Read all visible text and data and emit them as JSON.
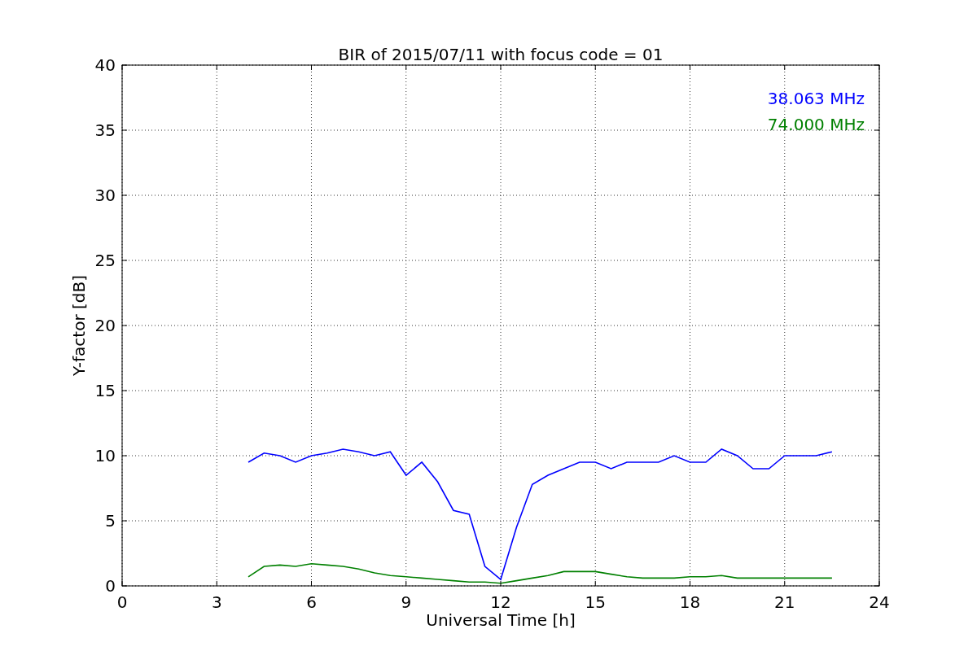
{
  "figure": {
    "chart_data": {
      "type": "line",
      "title": "BIR of 2015/07/11 with focus code = 01",
      "xlabel": "Universal Time [h]",
      "ylabel": "Y-factor [dB]",
      "x": [
        4.0,
        4.5,
        5.0,
        5.5,
        6.0,
        6.5,
        7.0,
        7.5,
        8.0,
        8.5,
        9.0,
        9.5,
        10.0,
        10.5,
        11.0,
        11.5,
        12.0,
        12.5,
        13.0,
        13.5,
        14.0,
        14.5,
        15.0,
        15.5,
        16.0,
        16.5,
        17.0,
        17.5,
        18.0,
        18.5,
        19.0,
        19.5,
        20.0,
        20.5,
        21.0,
        21.5,
        22.0,
        22.5
      ],
      "series": [
        {
          "name": "38.063 MHz",
          "color": "#0000ff",
          "values": [
            9.5,
            10.2,
            10,
            9.5,
            10,
            10.2,
            10.5,
            10.3,
            10,
            10.3,
            8.5,
            9.5,
            8,
            5.8,
            5.5,
            1.5,
            0.5,
            4.5,
            7.8,
            8.5,
            9,
            9.5,
            9.5,
            9,
            9.5,
            9.5,
            9.5,
            10,
            9.5,
            9.5,
            10.5,
            10,
            9,
            9,
            10,
            10,
            10,
            10.3
          ]
        },
        {
          "name": "74.000 MHz",
          "color": "#008000",
          "values": [
            0.7,
            1.5,
            1.6,
            1.5,
            1.7,
            1.6,
            1.5,
            1.3,
            1,
            0.8,
            0.7,
            0.6,
            0.5,
            0.4,
            0.3,
            0.3,
            0.2,
            0.4,
            0.6,
            0.8,
            1.1,
            1.1,
            1.1,
            0.9,
            0.7,
            0.6,
            0.6,
            0.6,
            0.7,
            0.7,
            0.8,
            0.6,
            0.6,
            0.6,
            0.6,
            0.6,
            0.6,
            0.6
          ]
        }
      ],
      "xlim": [
        0,
        24
      ],
      "ylim": [
        0,
        40
      ],
      "xticks": [
        0,
        3,
        6,
        9,
        12,
        15,
        18,
        21,
        24
      ],
      "yticks": [
        0,
        5,
        10,
        15,
        20,
        25,
        30,
        35,
        40
      ],
      "grid": true
    }
  }
}
